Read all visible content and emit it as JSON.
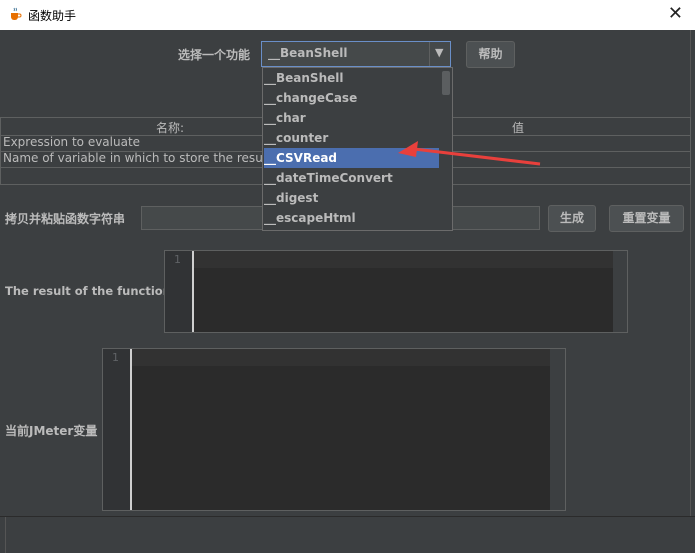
{
  "window": {
    "title": "函数助手",
    "close_glyph": "✕"
  },
  "function_select": {
    "label": "选择一个功能",
    "selected": "__BeanShell",
    "arrow": "▼",
    "help_button": "帮助"
  },
  "dropdown": {
    "items": [
      "__BeanShell",
      "__changeCase",
      "__char",
      "__counter",
      "__CSVRead",
      "__dateTimeConvert",
      "__digest",
      "__escapeHtml"
    ],
    "highlighted": "__CSVRead"
  },
  "params_table": {
    "headers": [
      "名称:",
      "值"
    ],
    "rows": [
      {
        "name": "Expression to evaluate",
        "value": ""
      },
      {
        "name": "Name of variable in which to store the result (op",
        "value": ""
      }
    ]
  },
  "copy_row": {
    "label": "拷贝并粘贴函数字符串",
    "value": "",
    "generate_button": "生成",
    "reset_button": "重置变量"
  },
  "result_panel": {
    "label": "The result of the function is",
    "line_number": "1"
  },
  "vars_panel": {
    "label": "当前JMeter变量",
    "line_number": "1"
  },
  "colors": {
    "background": "#3c3f41",
    "selection": "#4b6eaf",
    "annotation_arrow": "#e8403c"
  },
  "icons": {
    "app": "java-cup-icon",
    "close": "close-icon",
    "arrow": "red-annotation-arrow"
  }
}
